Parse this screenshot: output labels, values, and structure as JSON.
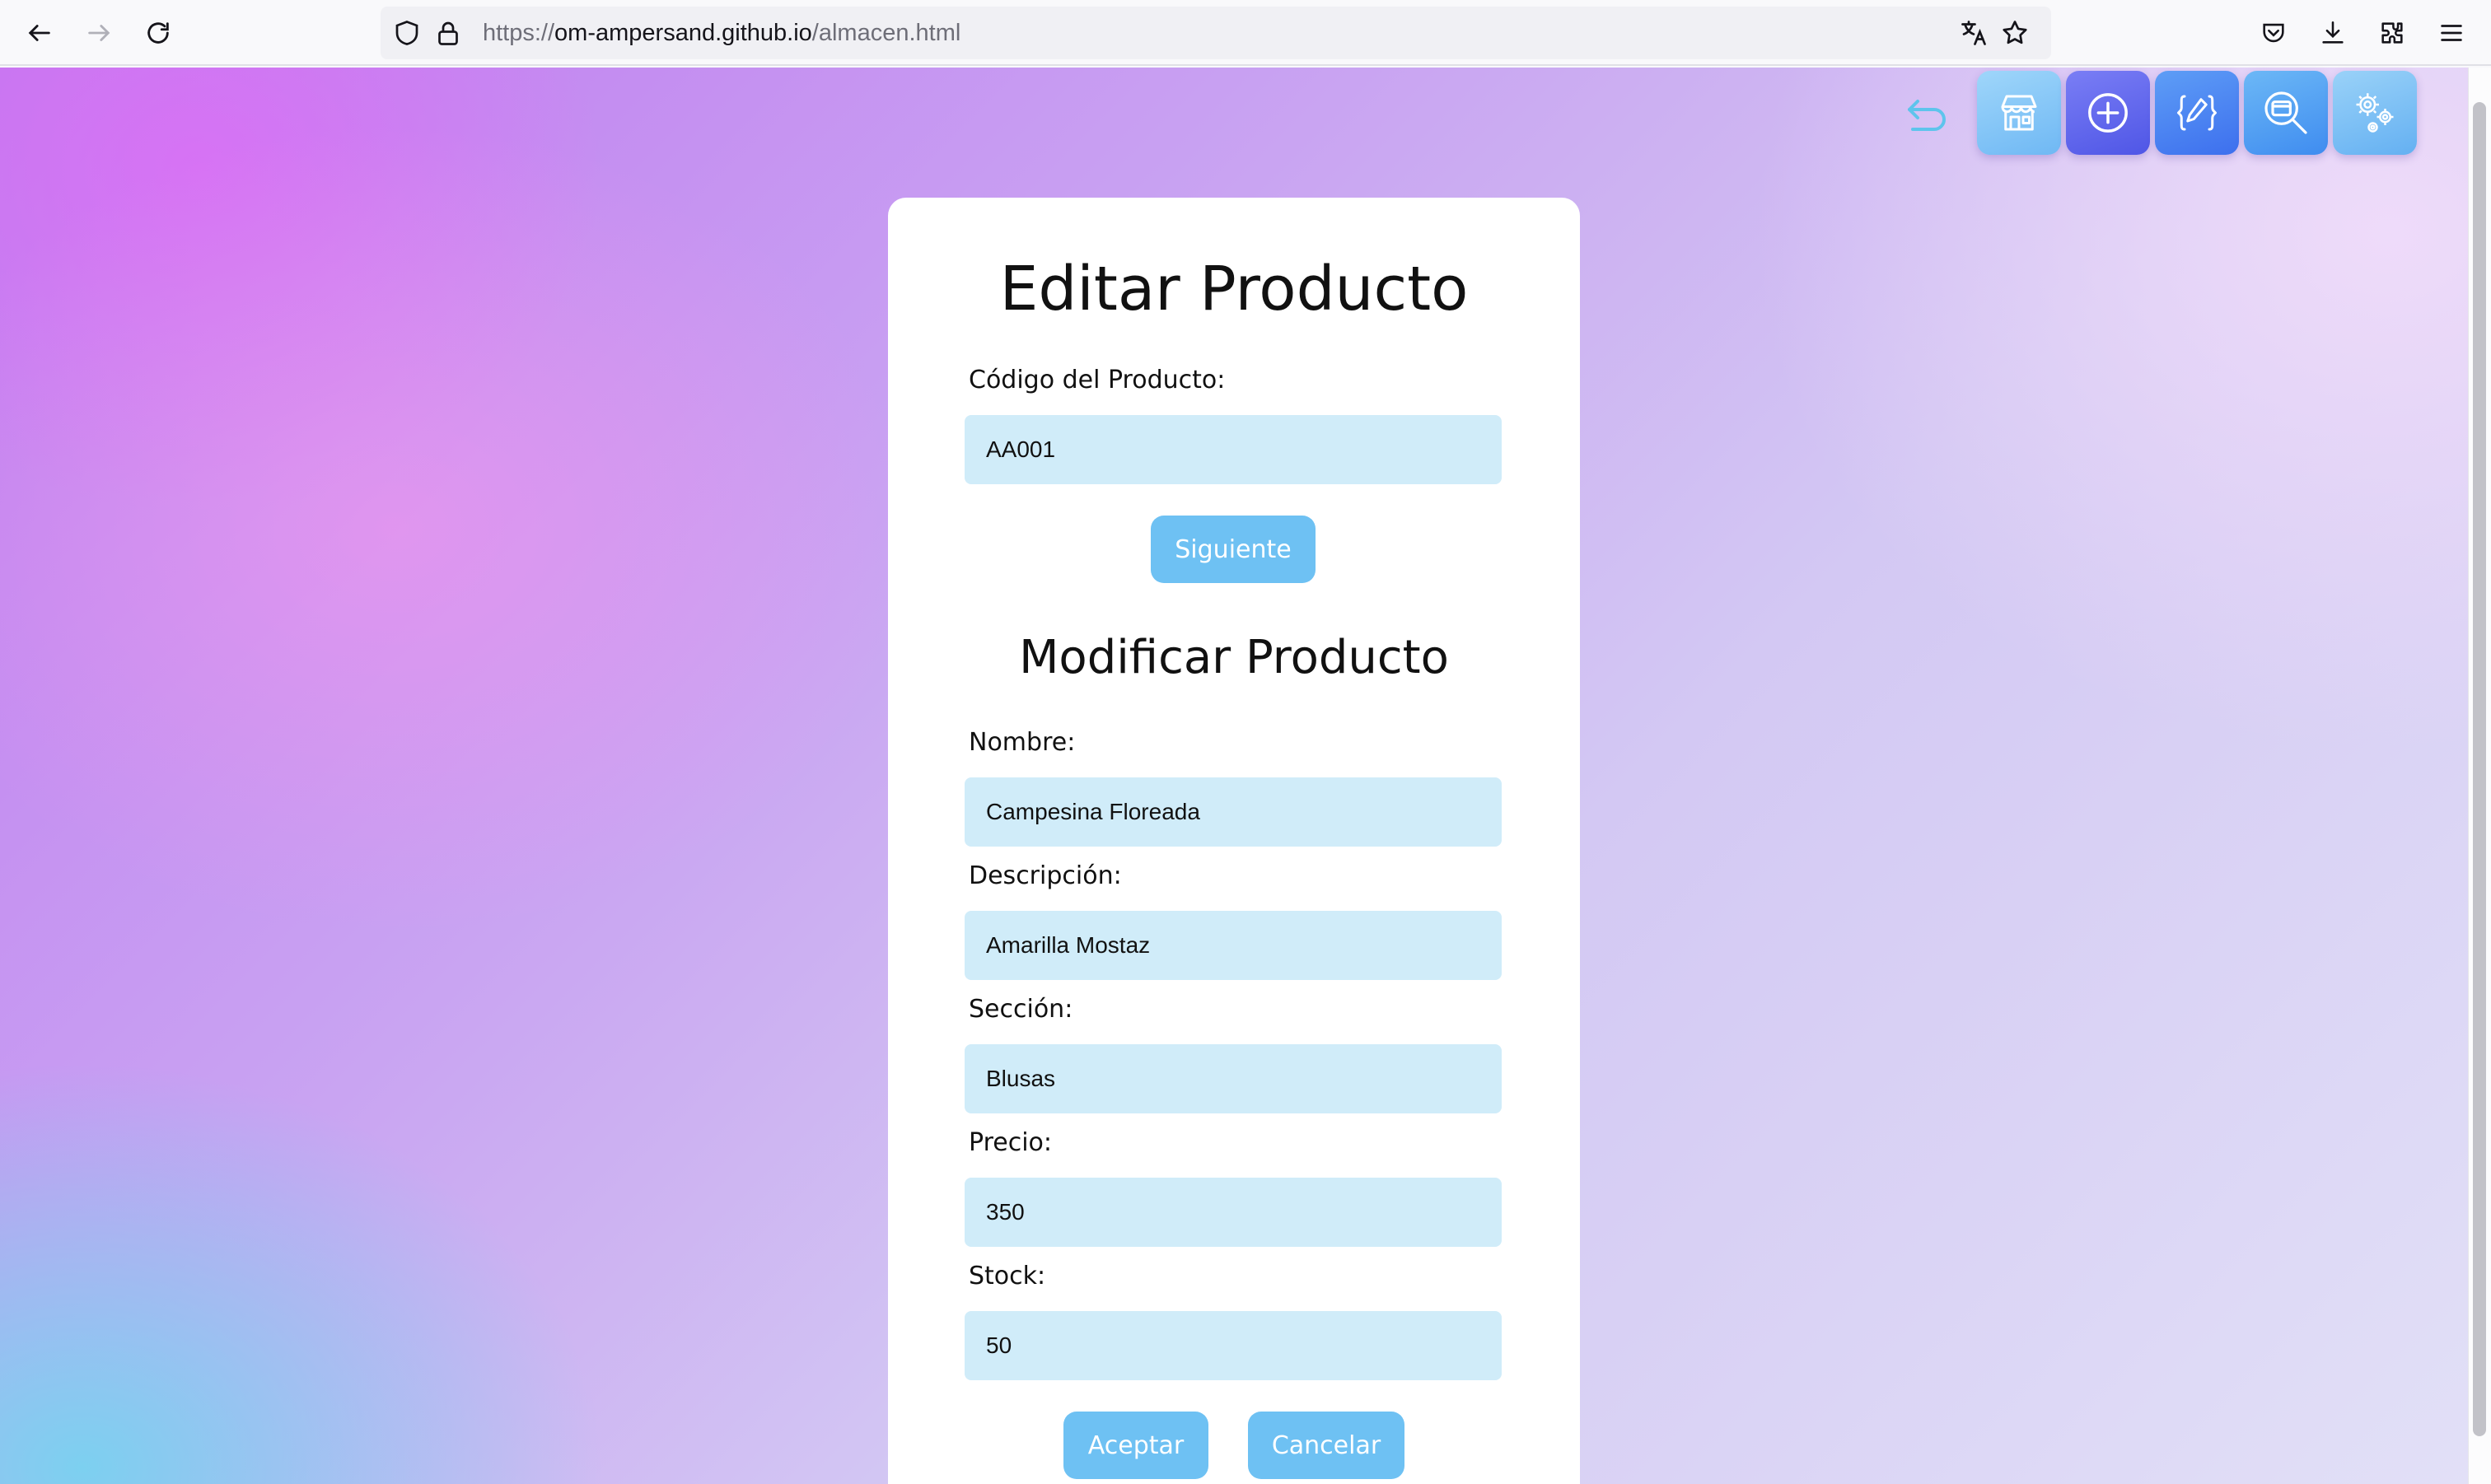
{
  "browser": {
    "url_scheme": "https://",
    "url_host": "om-ampersand.github.io",
    "url_path": "/almacen.html"
  },
  "toolbar": {
    "buttons": [
      {
        "name": "store-icon",
        "color": "#7cc3f7"
      },
      {
        "name": "add-circle-icon",
        "color": "#5b63f0"
      },
      {
        "name": "edit-icon",
        "color": "#4b86f2"
      },
      {
        "name": "search-icon",
        "color": "#4fa3f4"
      },
      {
        "name": "gears-icon",
        "color": "#6cb8f3"
      }
    ]
  },
  "form": {
    "title": "Editar Producto",
    "code_label": "Código del Producto:",
    "code_value": "AA001",
    "next_label": "Siguiente",
    "subtitle": "Modificar Producto",
    "fields": [
      {
        "label": "Nombre:",
        "value": "Campesina Floreada"
      },
      {
        "label": "Descripción:",
        "value": "Amarilla Mostaz"
      },
      {
        "label": "Sección:",
        "value": "Blusas"
      },
      {
        "label": "Precio:",
        "value": "350"
      },
      {
        "label": "Stock:",
        "value": "50"
      }
    ],
    "accept_label": "Aceptar",
    "cancel_label": "Cancelar"
  },
  "colors": {
    "button": "#6ec1f3",
    "field": "#d0ecf9"
  }
}
